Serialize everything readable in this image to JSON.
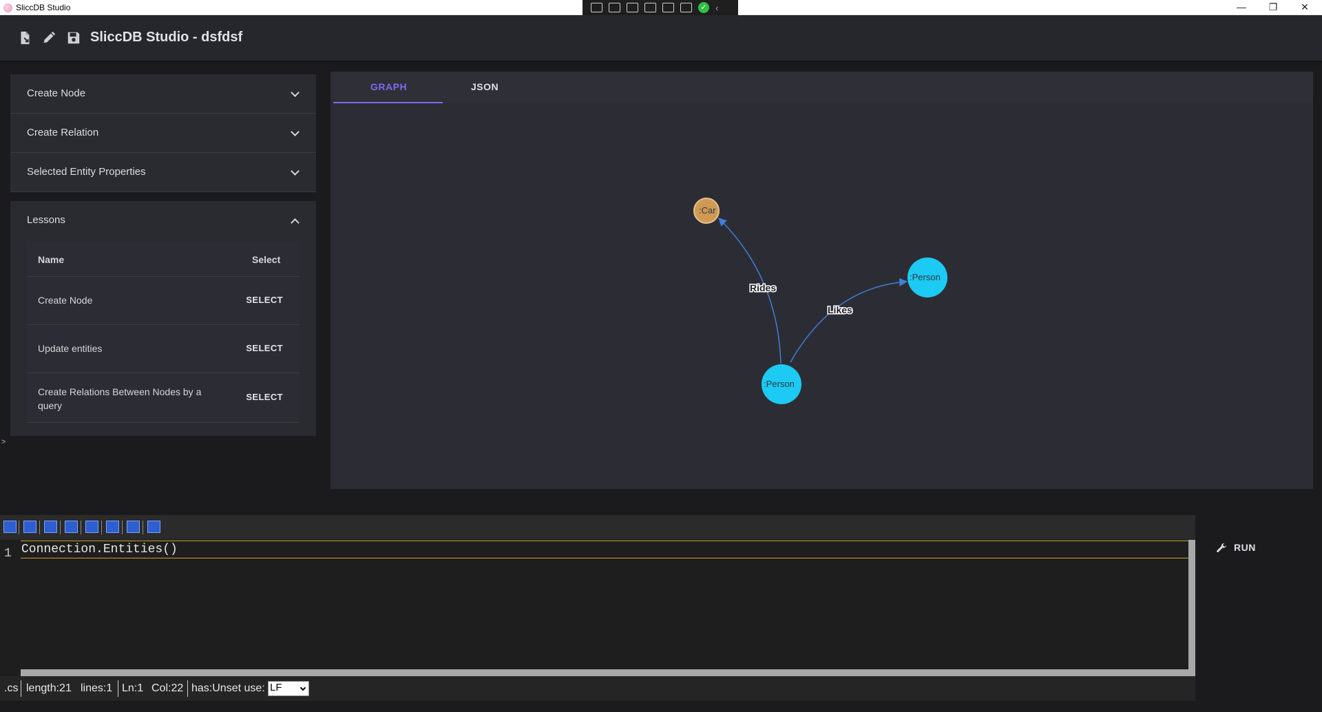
{
  "window": {
    "title": "SliccDB Studio",
    "controls": {
      "minimize": "—",
      "maximize": "❐",
      "close": "✕"
    }
  },
  "header": {
    "title": "SliccDB Studio - dsfdsf",
    "icons": [
      "new-file-icon",
      "edit-icon",
      "save-icon"
    ]
  },
  "sidebar": {
    "accordions": [
      {
        "label": "Create Node",
        "expanded": false
      },
      {
        "label": "Create Relation",
        "expanded": false
      },
      {
        "label": "Selected Entity Properties",
        "expanded": false
      }
    ],
    "lessons": {
      "label": "Lessons",
      "expanded": true,
      "columns": {
        "name": "Name",
        "select": "Select"
      },
      "rows": [
        {
          "name": "Create Node",
          "action": "SELECT"
        },
        {
          "name": "Update entities",
          "action": "SELECT"
        },
        {
          "name": "Create Relations Between Nodes by a query",
          "action": "SELECT"
        }
      ]
    },
    "caret": ">"
  },
  "graph": {
    "tabs": [
      {
        "label": "GRAPH",
        "active": true
      },
      {
        "label": "JSON",
        "active": false
      }
    ],
    "nodes": [
      {
        "id": "car",
        "label": ":Car",
        "color": "#d09a55"
      },
      {
        "id": "person1",
        "label": ":Person",
        "color": "#1ccaf4"
      },
      {
        "id": "person2",
        "label": ":Person",
        "color": "#1ccaf4"
      }
    ],
    "edges": [
      {
        "from": "person2",
        "to": "car",
        "label": "Rides",
        "color": "#3f7fd8"
      },
      {
        "from": "person2",
        "to": "person1",
        "label": "Likes",
        "color": "#3f7fd8"
      }
    ]
  },
  "editor": {
    "line_numbers": [
      "1"
    ],
    "code": "Connection.Entities()",
    "status": {
      "ext": ".cs",
      "length": "length:21",
      "lines": "lines:1",
      "ln": "Ln:1",
      "col": "Col:22",
      "hasUnset": "has:Unset use:",
      "eol_value": "LF"
    }
  },
  "run": {
    "label": "RUN"
  },
  "colors": {
    "accent": "#7b6cf0",
    "background": "#1b1b1e",
    "panel": "#2a2b31"
  }
}
